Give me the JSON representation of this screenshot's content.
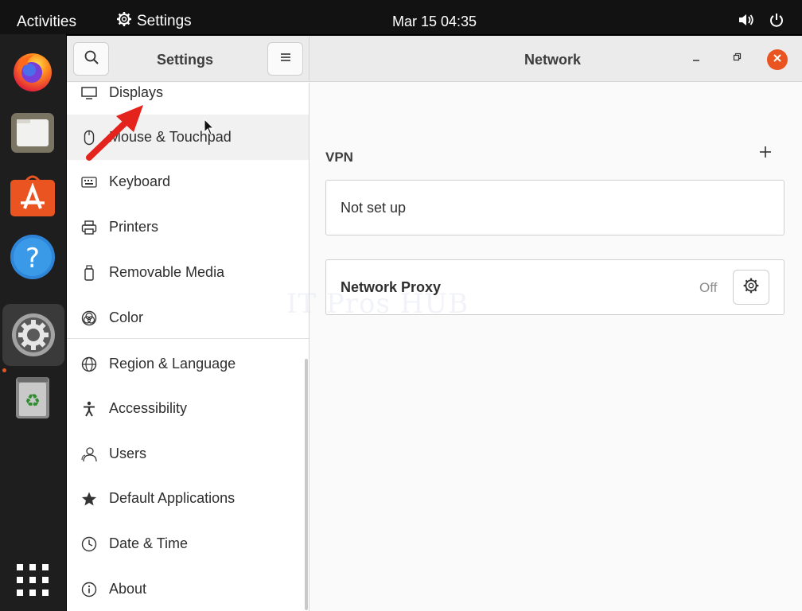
{
  "topbar": {
    "activities": "Activities",
    "app_name": "Settings",
    "clock": "Mar 15  04:35"
  },
  "dock": {
    "items": [
      "firefox-icon",
      "files-icon",
      "software-icon",
      "help-icon",
      "settings-icon",
      "trash-icon"
    ],
    "apps_grid": "show-applications-icon"
  },
  "window": {
    "sidebar_title": "Settings",
    "page_title": "Network"
  },
  "sidebar": {
    "items": [
      {
        "label": "Displays",
        "icon": "display-icon"
      },
      {
        "label": "Mouse & Touchpad",
        "icon": "mouse-icon"
      },
      {
        "label": "Keyboard",
        "icon": "keyboard-icon"
      },
      {
        "label": "Printers",
        "icon": "printer-icon"
      },
      {
        "label": "Removable Media",
        "icon": "removable-media-icon"
      },
      {
        "label": "Color",
        "icon": "color-icon"
      },
      {
        "label": "Region & Language",
        "icon": "globe-icon"
      },
      {
        "label": "Accessibility",
        "icon": "accessibility-icon"
      },
      {
        "label": "Users",
        "icon": "users-icon"
      },
      {
        "label": "Default Applications",
        "icon": "star-icon"
      },
      {
        "label": "Date & Time",
        "icon": "clock-icon"
      },
      {
        "label": "About",
        "icon": "info-icon"
      }
    ]
  },
  "network": {
    "vpn_title": "VPN",
    "vpn_status": "Not set up",
    "proxy_label": "Network Proxy",
    "proxy_status": "Off"
  },
  "watermark": "IT Pros HUB",
  "colors": {
    "accent": "#e95420",
    "annotation_arrow": "#e3231c"
  }
}
